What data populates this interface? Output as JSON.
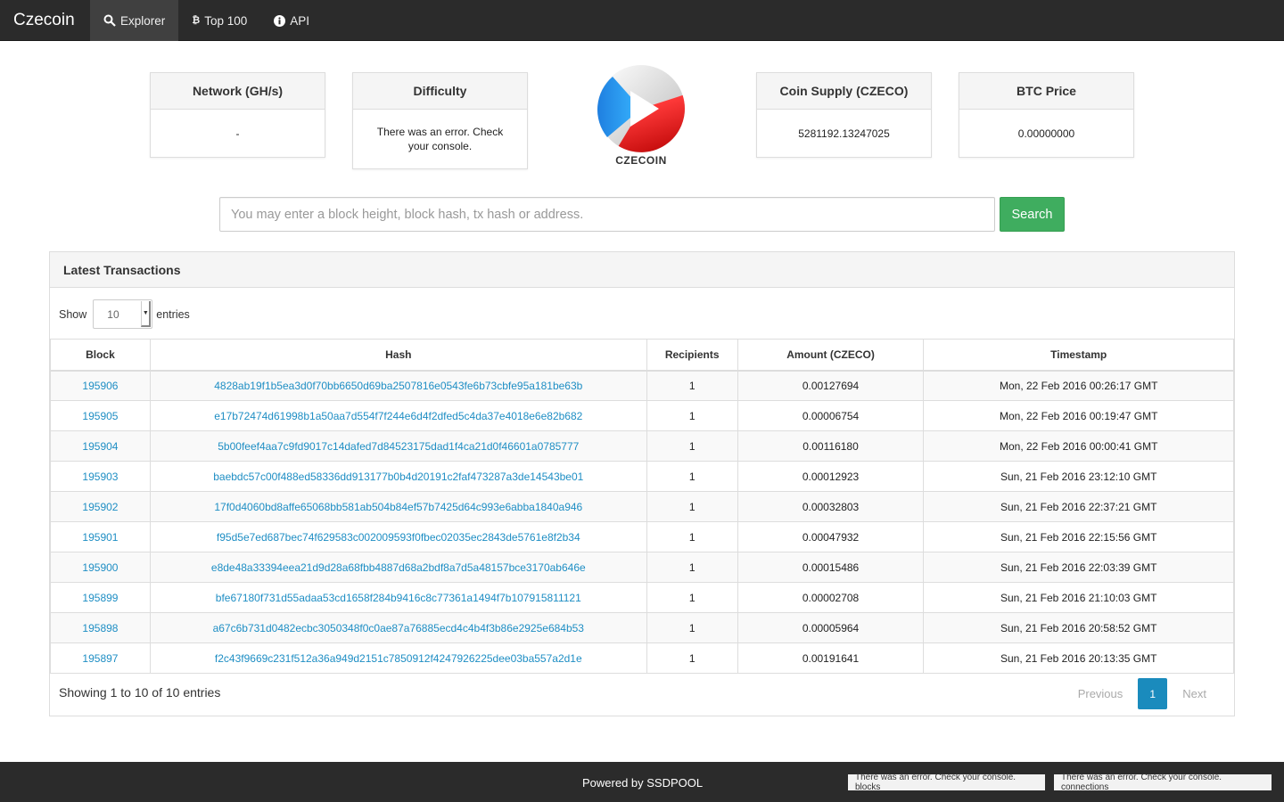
{
  "navbar": {
    "brand": "Czecoin",
    "items": [
      {
        "label": "Explorer",
        "icon": "search-icon",
        "active": true
      },
      {
        "label": "Top 100",
        "icon": "bitcoin-icon",
        "active": false
      },
      {
        "label": "API",
        "icon": "info-icon",
        "active": false
      }
    ]
  },
  "stats": {
    "network": {
      "title": "Network (GH/s)",
      "value": "-"
    },
    "difficulty": {
      "title": "Difficulty",
      "value": "There was an error. Check your console."
    },
    "supply": {
      "title": "Coin Supply (CZECO)",
      "value": "5281192.13247025"
    },
    "btc_price": {
      "title": "BTC Price",
      "value": "0.00000000"
    }
  },
  "logo": {
    "text": "CZECOIN"
  },
  "search": {
    "placeholder": "You may enter a block height, block hash, tx hash or address.",
    "button_label": "Search"
  },
  "transactions": {
    "title": "Latest Transactions",
    "show_label": "Show",
    "entries_label": "entries",
    "page_length": "10",
    "columns": [
      "Block",
      "Hash",
      "Recipients",
      "Amount (CZECO)",
      "Timestamp"
    ],
    "rows": [
      {
        "block": "195906",
        "hash": "4828ab19f1b5ea3d0f70bb6650d69ba2507816e0543fe6b73cbfe95a181be63b",
        "recipients": "1",
        "amount": "0.00127694",
        "timestamp": "Mon, 22 Feb 2016 00:26:17 GMT"
      },
      {
        "block": "195905",
        "hash": "e17b72474d61998b1a50aa7d554f7f244e6d4f2dfed5c4da37e4018e6e82b682",
        "recipients": "1",
        "amount": "0.00006754",
        "timestamp": "Mon, 22 Feb 2016 00:19:47 GMT"
      },
      {
        "block": "195904",
        "hash": "5b00feef4aa7c9fd9017c14dafed7d84523175dad1f4ca21d0f46601a0785777",
        "recipients": "1",
        "amount": "0.00116180",
        "timestamp": "Mon, 22 Feb 2016 00:00:41 GMT"
      },
      {
        "block": "195903",
        "hash": "baebdc57c00f488ed58336dd913177b0b4d20191c2faf473287a3de14543be01",
        "recipients": "1",
        "amount": "0.00012923",
        "timestamp": "Sun, 21 Feb 2016 23:12:10 GMT"
      },
      {
        "block": "195902",
        "hash": "17f0d4060bd8affe65068bb581ab504b84ef57b7425d64c993e6abba1840a946",
        "recipients": "1",
        "amount": "0.00032803",
        "timestamp": "Sun, 21 Feb 2016 22:37:21 GMT"
      },
      {
        "block": "195901",
        "hash": "f95d5e7ed687bec74f629583c002009593f0fbec02035ec2843de5761e8f2b34",
        "recipients": "1",
        "amount": "0.00047932",
        "timestamp": "Sun, 21 Feb 2016 22:15:56 GMT"
      },
      {
        "block": "195900",
        "hash": "e8de48a33394eea21d9d28a68fbb4887d68a2bdf8a7d5a48157bce3170ab646e",
        "recipients": "1",
        "amount": "0.00015486",
        "timestamp": "Sun, 21 Feb 2016 22:03:39 GMT"
      },
      {
        "block": "195899",
        "hash": "bfe67180f731d55adaa53cd1658f284b9416c8c77361a1494f7b107915811121",
        "recipients": "1",
        "amount": "0.00002708",
        "timestamp": "Sun, 21 Feb 2016 21:10:03 GMT"
      },
      {
        "block": "195898",
        "hash": "a67c6b731d0482ecbc3050348f0c0ae87a76885ecd4c4b4f3b86e2925e684b53",
        "recipients": "1",
        "amount": "0.00005964",
        "timestamp": "Sun, 21 Feb 2016 20:58:52 GMT"
      },
      {
        "block": "195897",
        "hash": "f2c43f9669c231f512a36a949d2151c7850912f4247926225dee03ba557a2d1e",
        "recipients": "1",
        "amount": "0.00191641",
        "timestamp": "Sun, 21 Feb 2016 20:13:35 GMT"
      }
    ],
    "info": "Showing 1 to 10 of 10 entries",
    "pagination": {
      "previous": "Previous",
      "current": "1",
      "next": "Next"
    }
  },
  "footer": {
    "powered": "Powered by SSDPOOL",
    "badges": [
      "There was an error. Check your console. blocks",
      "There was an error. Check your console. connections"
    ]
  },
  "colors": {
    "accent_green": "#3fad5f",
    "link_blue": "#1e8ec4",
    "page_active": "#1a8bbd",
    "navbar": "#2b2b2b"
  }
}
